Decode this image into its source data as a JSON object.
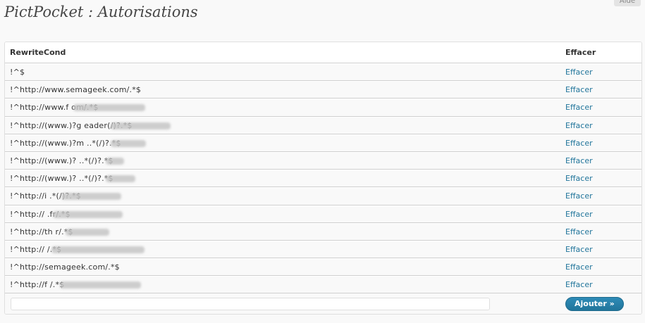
{
  "help_tab": "Aide",
  "page_title": "PictPocket : Autorisations",
  "table": {
    "headers": [
      "RewriteCond",
      "Effacer"
    ],
    "rows": [
      {
        "cond": "!^$",
        "action": "Effacer"
      },
      {
        "cond": "!^http://www.semageek.com/.*$",
        "action": "Effacer"
      },
      {
        "cond": "!^http://www.f                              om/.*$",
        "action": "Effacer"
      },
      {
        "cond": "!^http://(www.)?g                              eader(/)?.*$",
        "action": "Effacer"
      },
      {
        "cond": "!^http://(www.)?m                  ..*(/)?.*$",
        "action": "Effacer"
      },
      {
        "cond": "!^http://(www.)?          ..*(/)?.*$",
        "action": "Effacer"
      },
      {
        "cond": "!^http://(www.)?                ..*(/)?.*$",
        "action": "Effacer"
      },
      {
        "cond": "!^http://i                              .*(/)?.*$",
        "action": "Effacer"
      },
      {
        "cond": "!^http://                                   .fr/.*$",
        "action": "Effacer"
      },
      {
        "cond": "!^http://th                        r/.*$",
        "action": "Effacer"
      },
      {
        "cond": "!^http://                                             /.*$",
        "action": "Effacer"
      },
      {
        "cond": "!^http://semageek.com/.*$",
        "action": "Effacer"
      },
      {
        "cond": "!^http://f                                        /.*$",
        "action": "Effacer"
      }
    ]
  },
  "add_input": {
    "value": "",
    "placeholder": ""
  },
  "add_button": "Ajouter »"
}
